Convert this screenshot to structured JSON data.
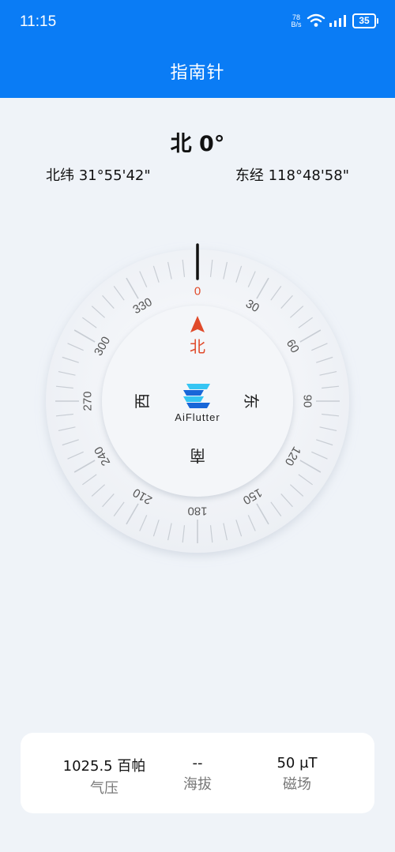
{
  "status": {
    "time": "11:15",
    "net_speed_value": "78",
    "net_speed_unit": "B/s",
    "battery": "35"
  },
  "app_bar": {
    "title": "指南针"
  },
  "heading": "北 0°",
  "coords": {
    "lat": "北纬 31°55'42\"",
    "lon": "东经 118°48'58\""
  },
  "compass": {
    "degree_labels": [
      "0",
      "30",
      "60",
      "90",
      "120",
      "150",
      "180",
      "210",
      "240",
      "270",
      "300",
      "330"
    ],
    "cardinals": {
      "north": "北",
      "east": "东",
      "south": "南",
      "west": "西"
    },
    "logo_text": "AiFlutter",
    "colors": {
      "north": "#e04a2a",
      "logo_dark": "#1866d8",
      "logo_light": "#35c5f3"
    }
  },
  "info": [
    {
      "value": "1025.5 百帕",
      "label": "气压"
    },
    {
      "value": "--",
      "label": "海拔"
    },
    {
      "value": "50 µT",
      "label": "磁场"
    }
  ]
}
